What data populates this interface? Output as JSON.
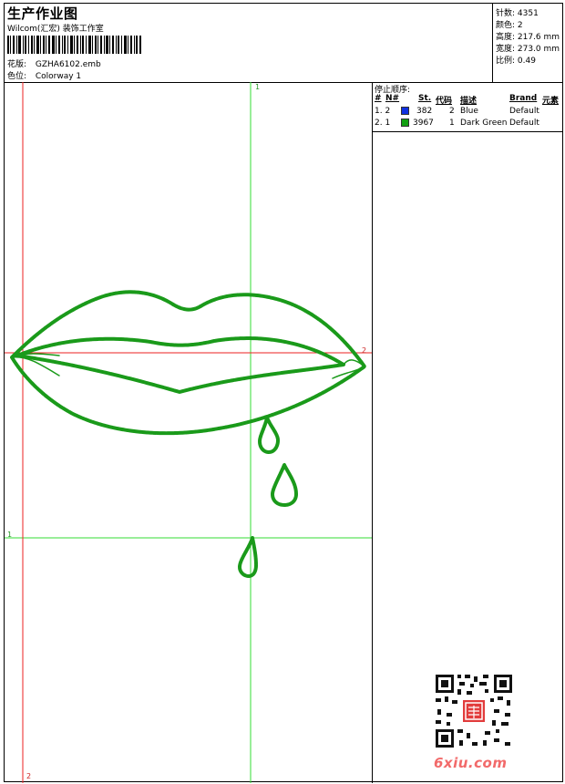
{
  "header": {
    "title": "生产作业图",
    "subtitle": "Wilcom(汇宏) 装饰工作室",
    "barcode_label": "barcode",
    "pattern_label": "花版:",
    "pattern_value": "GZHA6102.emb",
    "colorway_label": "色位:",
    "colorway_value": "Colorway 1"
  },
  "stats": {
    "stitches": "针数: 4351",
    "colors": "颜色: 2",
    "height": "高度: 217.6 mm",
    "width": "宽度: 273.0 mm",
    "scale": "比例: 0.49"
  },
  "stop_sequence": {
    "title": "停止顺序:",
    "columns": [
      "#",
      "N#",
      "St.",
      "代码",
      "描述",
      "Brand",
      "元素"
    ],
    "rows": [
      {
        "idx": "1. 2",
        "swatch": "#1030e0",
        "stitches": "382",
        "code": "2",
        "desc": "Blue",
        "brand": "Default"
      },
      {
        "idx": "2. 1",
        "swatch": "#12a012",
        "stitches": "3967",
        "code": "1",
        "desc": "Dark Green",
        "brand": "Default"
      }
    ]
  },
  "guides": {
    "top_label": "1",
    "right_label": "2",
    "left_label": "1",
    "bottom_label": "2"
  },
  "colors": {
    "stitch": "#1a9a1a",
    "guide_green": "#33dd33",
    "guide_red": "#ee2222"
  },
  "watermark": "6xiu.com"
}
